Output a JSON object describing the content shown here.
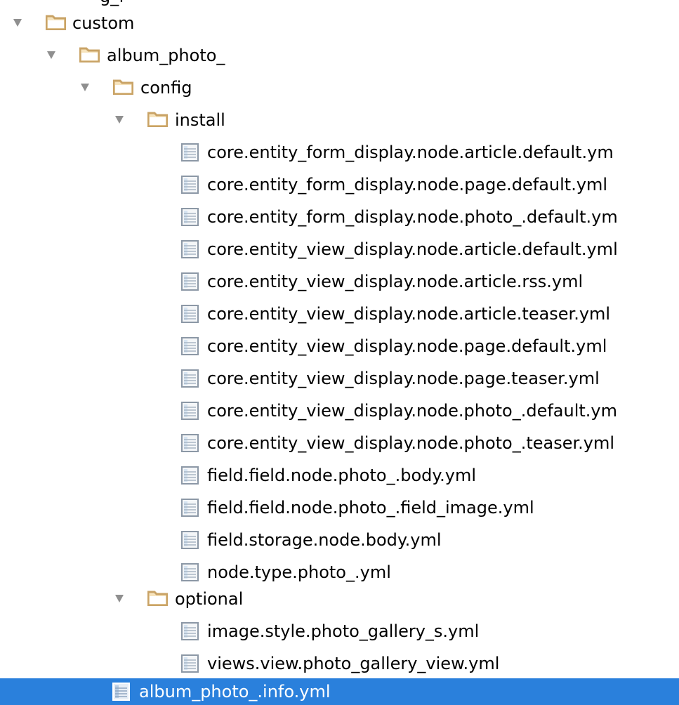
{
  "tree": {
    "partial_top_label": "g_f",
    "rows": [
      {
        "label": "custom",
        "type": "folder",
        "expanded": true,
        "icon": "folder-icon"
      },
      {
        "label": "album_photo_",
        "type": "folder",
        "expanded": true,
        "icon": "folder-icon"
      },
      {
        "label": "config",
        "type": "folder",
        "expanded": true,
        "icon": "folder-icon"
      },
      {
        "label": "install",
        "type": "folder",
        "expanded": true,
        "icon": "folder-icon"
      },
      {
        "label": "core.entity_form_display.node.article.default.ym",
        "type": "file",
        "icon": "yml-file-icon"
      },
      {
        "label": "core.entity_form_display.node.page.default.yml",
        "type": "file",
        "icon": "yml-file-icon"
      },
      {
        "label": "core.entity_form_display.node.photo_.default.ym",
        "type": "file",
        "icon": "yml-file-icon"
      },
      {
        "label": "core.entity_view_display.node.article.default.yml",
        "type": "file",
        "icon": "yml-file-icon"
      },
      {
        "label": "core.entity_view_display.node.article.rss.yml",
        "type": "file",
        "icon": "yml-file-icon"
      },
      {
        "label": "core.entity_view_display.node.article.teaser.yml",
        "type": "file",
        "icon": "yml-file-icon"
      },
      {
        "label": "core.entity_view_display.node.page.default.yml",
        "type": "file",
        "icon": "yml-file-icon"
      },
      {
        "label": "core.entity_view_display.node.page.teaser.yml",
        "type": "file",
        "icon": "yml-file-icon"
      },
      {
        "label": "core.entity_view_display.node.photo_.default.ym",
        "type": "file",
        "icon": "yml-file-icon"
      },
      {
        "label": "core.entity_view_display.node.photo_.teaser.yml",
        "type": "file",
        "icon": "yml-file-icon"
      },
      {
        "label": "field.field.node.photo_.body.yml",
        "type": "file",
        "icon": "yml-file-icon"
      },
      {
        "label": "field.field.node.photo_.field_image.yml",
        "type": "file",
        "icon": "yml-file-icon"
      },
      {
        "label": "field.storage.node.body.yml",
        "type": "file",
        "icon": "yml-file-icon"
      },
      {
        "label": "node.type.photo_.yml",
        "type": "file",
        "icon": "yml-file-icon"
      },
      {
        "label": "optional",
        "type": "folder",
        "expanded": true,
        "icon": "folder-icon"
      },
      {
        "label": "image.style.photo_gallery_s.yml",
        "type": "file",
        "icon": "yml-file-icon"
      },
      {
        "label": "views.view.photo_gallery_view.yml",
        "type": "file",
        "icon": "yml-file-icon"
      },
      {
        "label": "album_photo_.info.yml",
        "type": "file",
        "icon": "yml-file-icon",
        "selected": true
      }
    ]
  },
  "colors": {
    "selection": "#2a80dc",
    "folder": "#c9a366",
    "arrow": "#8f8f8f",
    "file_icon": "#7f8fa0"
  }
}
